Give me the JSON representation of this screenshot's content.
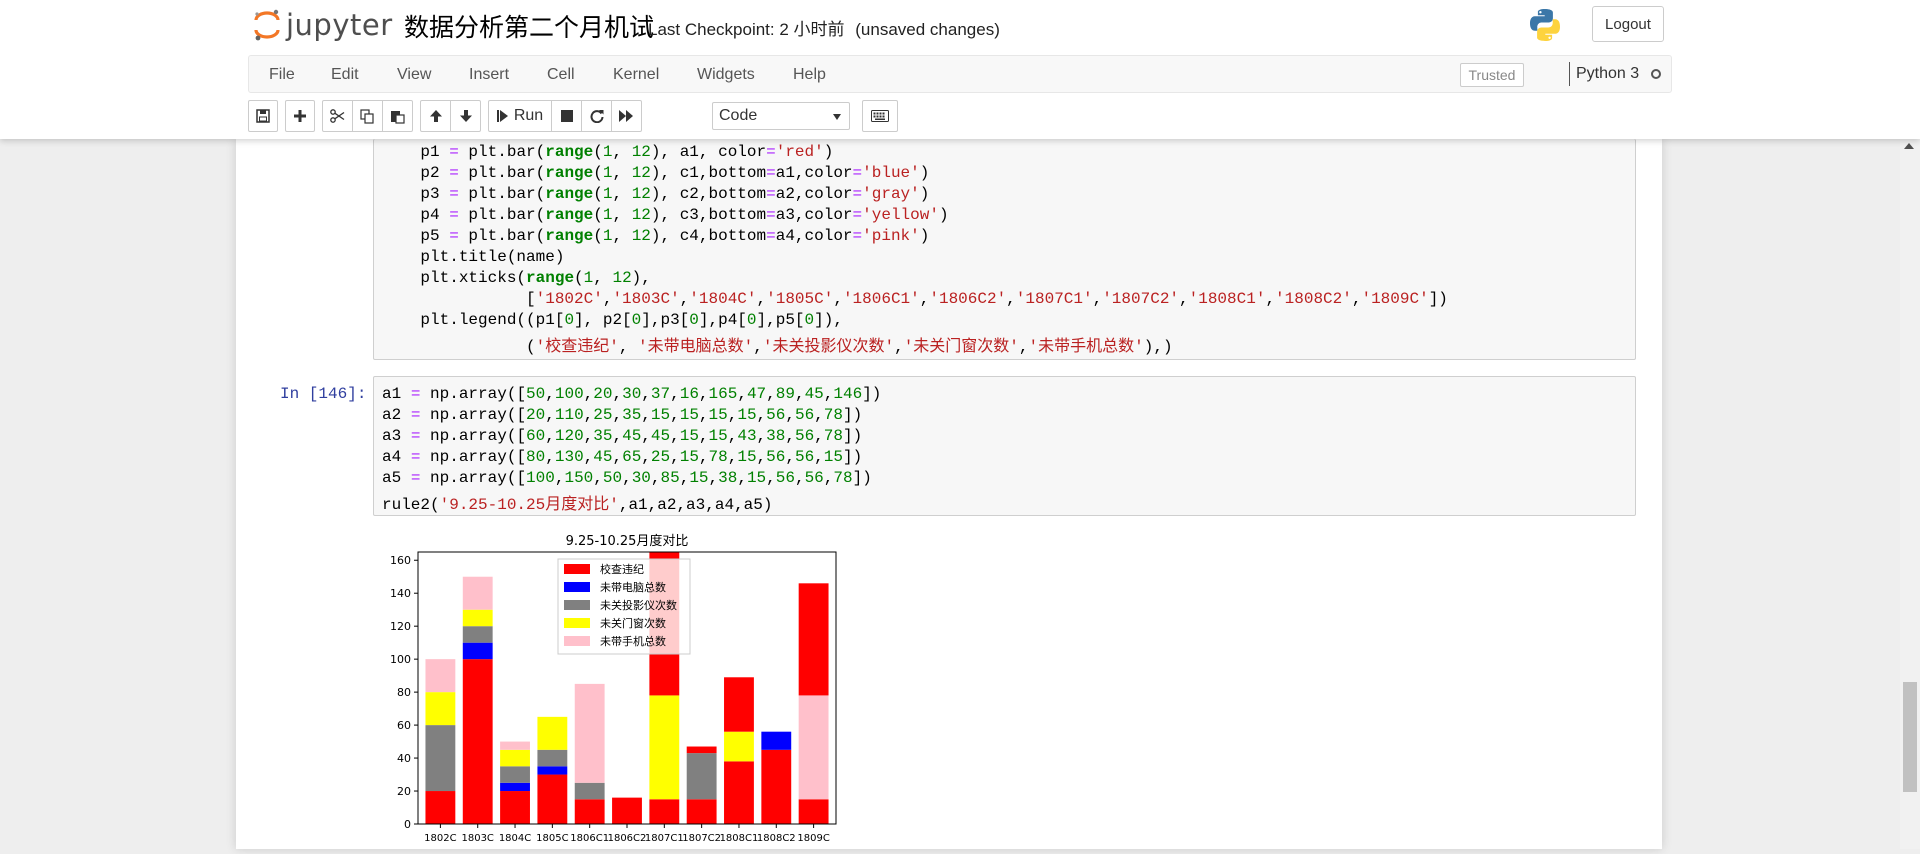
{
  "header": {
    "logo_text": "jupyter",
    "notebook_name": "数据分析第二个月机试",
    "checkpoint": "Last Checkpoint: 2 小时前",
    "save_status": "(unsaved changes)",
    "logout_label": "Logout"
  },
  "menubar": {
    "items": [
      "File",
      "Edit",
      "View",
      "Insert",
      "Cell",
      "Kernel",
      "Widgets",
      "Help"
    ],
    "trusted": "Trusted",
    "kernel": "Python 3"
  },
  "toolbar": {
    "run_label": "Run",
    "cell_type": "Code"
  },
  "cell1": {
    "lines": [
      "    p1 = plt.bar(range(1, 12), a1, color='red')",
      "    p2 = plt.bar(range(1, 12), c1,bottom=a1,color='blue')",
      "    p3 = plt.bar(range(1, 12), c2,bottom=a2,color='gray')",
      "    p4 = plt.bar(range(1, 12), c3,bottom=a3,color='yellow')",
      "    p5 = plt.bar(range(1, 12), c4,bottom=a4,color='pink')",
      "    plt.title(name)",
      "    plt.xticks(range(1, 12),",
      "               ['1802C','1803C','1804C','1805C','1806C1','1806C2','1807C1','1807C2','1808C1','1808C2','1809C'])",
      "    plt.legend((p1[0], p2[0],p3[0],p4[0],p5[0]),",
      "               ('校查违纪', '未带电脑总数','未关投影仪次数','未关门窗次数','未带手机总数'),)"
    ]
  },
  "cell2": {
    "prompt": "In  [146]:",
    "lines": [
      "a1 = np.array([50,100,20,30,37,16,165,47,89,45,146])",
      "a2 = np.array([20,110,25,35,15,15,15,15,56,56,78])",
      "a3 = np.array([60,120,35,45,45,15,15,43,38,56,78])",
      "a4 = np.array([80,130,45,65,25,15,78,15,56,56,15])",
      "a5 = np.array([100,150,50,30,85,15,38,15,56,56,78])",
      "rule2('9.25-10.25月度对比',a1,a2,a3,a4,a5)"
    ]
  },
  "chart_data": {
    "type": "bar",
    "stacked": true,
    "title": "9.25-10.25月度对比",
    "categories": [
      "1802C",
      "1803C",
      "1804C",
      "1805C",
      "1806C1",
      "1806C2",
      "1807C1",
      "1807C2",
      "1808C1",
      "1808C2",
      "1809C"
    ],
    "ylim": [
      0,
      165
    ],
    "yticks": [
      0,
      20,
      40,
      60,
      80,
      100,
      120,
      140,
      160
    ],
    "legend_position": "top-center",
    "series": [
      {
        "name": "校查违纪",
        "color": "#ff0000",
        "values": [
          20,
          100,
          20,
          30,
          15,
          16,
          15,
          15,
          38,
          45,
          15
        ],
        "bottom": [
          0,
          0,
          0,
          0,
          0,
          0,
          0,
          0,
          0,
          0,
          0
        ]
      },
      {
        "name": "未带电脑总数",
        "color": "#0000ff",
        "values": [
          0,
          10,
          5,
          5,
          0,
          0,
          0,
          0,
          0,
          11,
          0
        ],
        "bottom": [
          20,
          100,
          20,
          30,
          15,
          15,
          15,
          15,
          38,
          45,
          15
        ]
      },
      {
        "name": "未关投影仪次数",
        "color": "#808080",
        "values": [
          40,
          10,
          10,
          10,
          10,
          0,
          0,
          28,
          0,
          0,
          0
        ],
        "bottom": [
          20,
          110,
          25,
          35,
          15,
          15,
          15,
          15,
          56,
          56,
          78
        ]
      },
      {
        "name": "未关门窗次数",
        "color": "#ffff00",
        "values": [
          20,
          10,
          10,
          20,
          0,
          0,
          63,
          0,
          18,
          0,
          0
        ],
        "bottom": [
          60,
          120,
          35,
          45,
          25,
          15,
          15,
          43,
          38,
          56,
          78
        ]
      },
      {
        "name": "未带手机总数",
        "color": "#ffc0cb",
        "values": [
          20,
          20,
          5,
          0,
          60,
          0,
          0,
          0,
          0,
          0,
          63
        ],
        "bottom": [
          80,
          130,
          45,
          65,
          25,
          15,
          78,
          15,
          56,
          56,
          15
        ]
      },
      {
        "name": "",
        "color": "#ff0000",
        "values": [
          0,
          0,
          0,
          0,
          0,
          0,
          87,
          4,
          33,
          0,
          68
        ],
        "bottom": [
          0,
          0,
          0,
          0,
          0,
          0,
          78,
          43,
          56,
          0,
          78
        ]
      }
    ]
  }
}
